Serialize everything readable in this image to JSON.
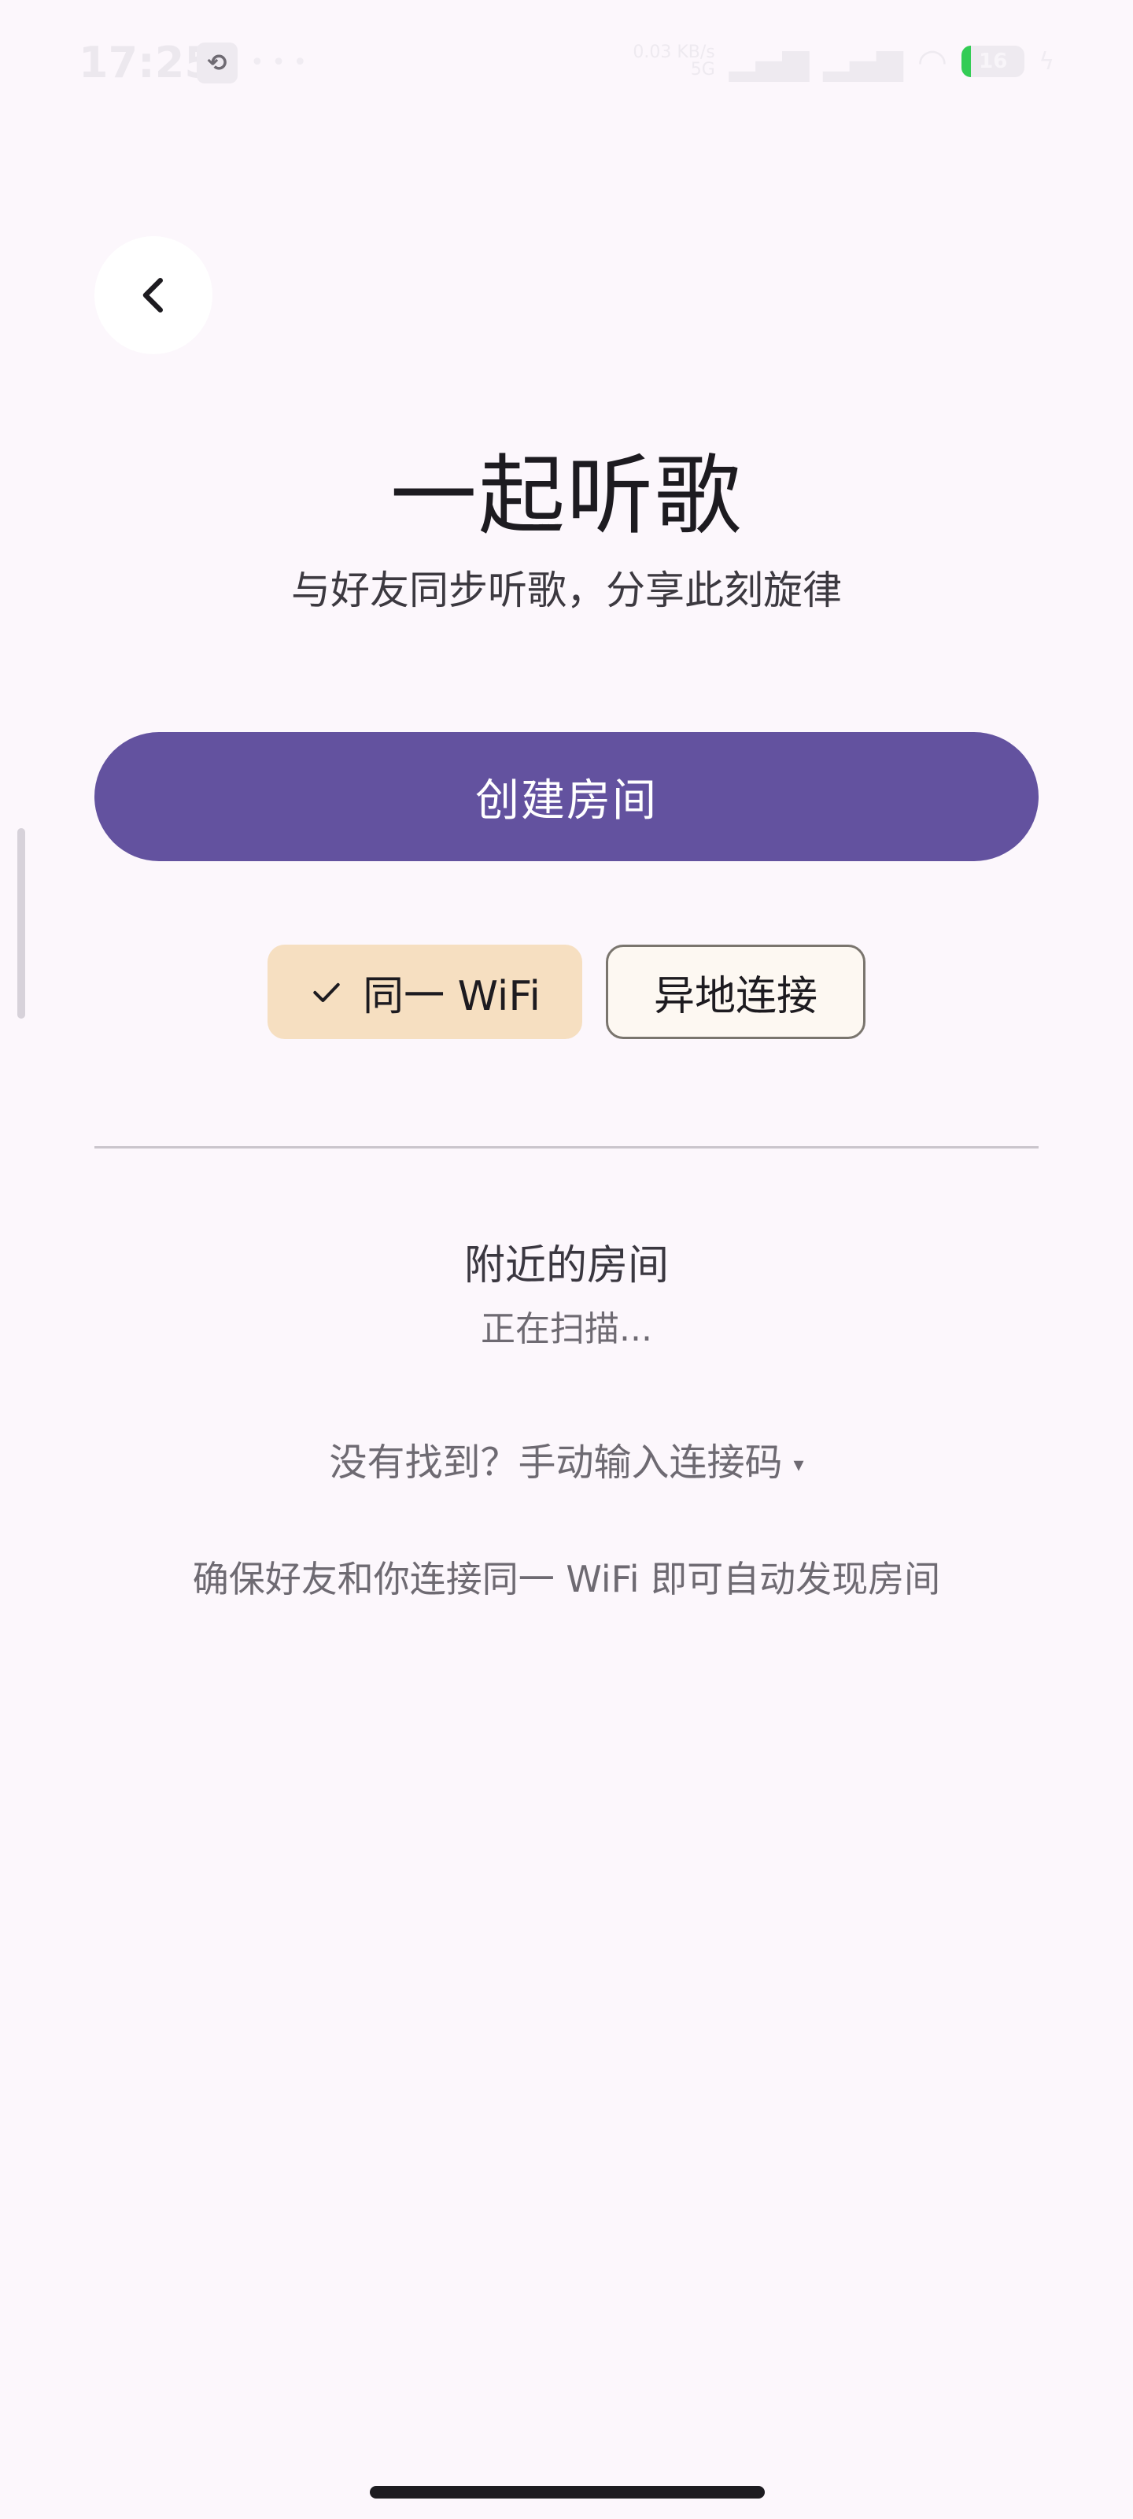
{
  "status_bar": {
    "time": "17:25",
    "app_icon": "app-notification-icon",
    "dots": "• • •",
    "net_speed_top": "0.03 KB/s",
    "net_speed_bottom": "5G",
    "battery_level": "16",
    "battery_color": "#33cc55"
  },
  "header": {
    "back_icon": "chevron-left-icon"
  },
  "page": {
    "title": "一起听歌",
    "subtitle": "与好友同步听歌，分享此刻旋律"
  },
  "actions": {
    "create_room": "创建房间"
  },
  "mode_chips": [
    {
      "label": "同一 WiFi",
      "selected": true,
      "icon": "check-icon"
    },
    {
      "label": "异地连接",
      "selected": false
    }
  ],
  "nearby": {
    "title": "附近的房间",
    "status": "正在扫描...",
    "manual_entry": "没有找到？手动输入连接码",
    "manual_caret": "▾",
    "hint": "确保好友和你连接同一 WiFi 即可自动发现房间"
  },
  "colors": {
    "primary": "#63529f",
    "selected_chip": "#f6dfc1",
    "background": "#fcf7fc"
  }
}
